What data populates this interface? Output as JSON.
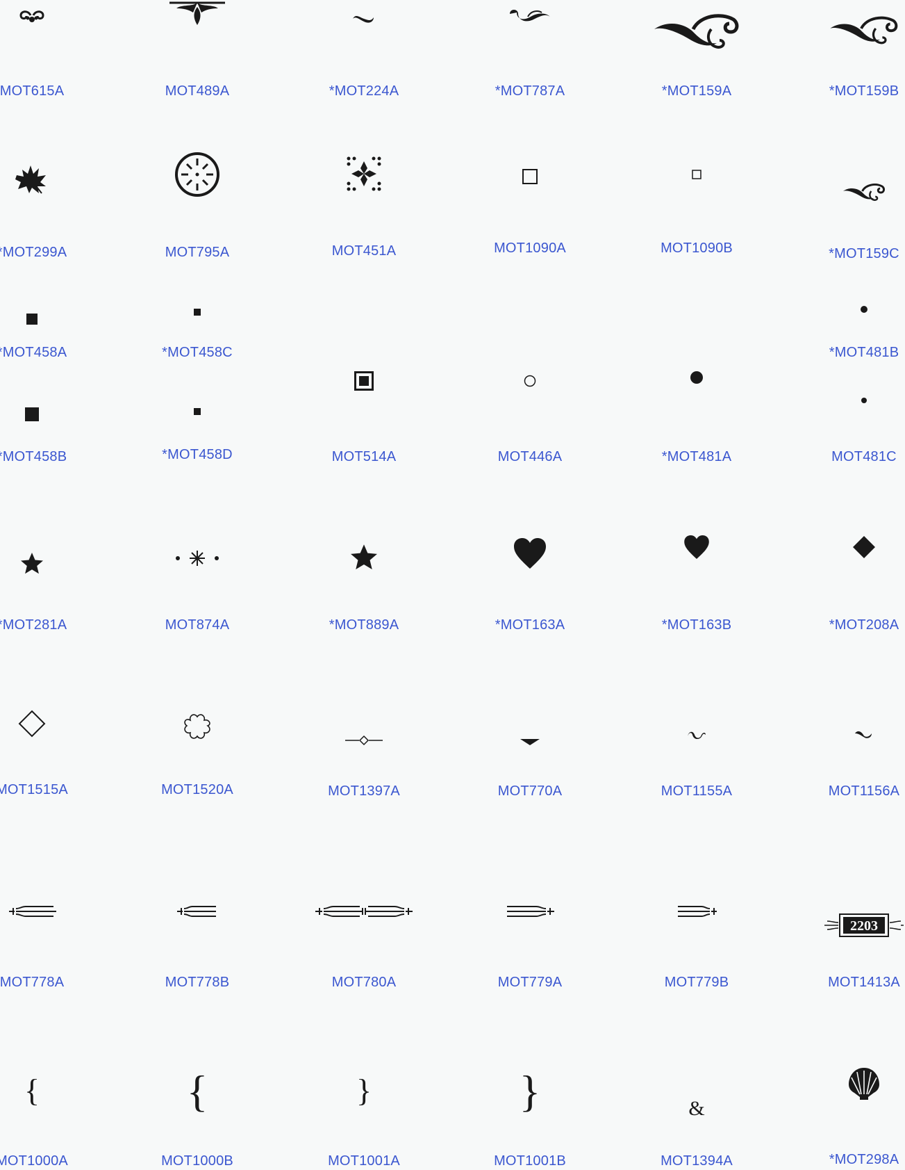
{
  "colors": {
    "background": "#f7f9f9",
    "link": "#3b57d0",
    "glyph": "#1a1a1a"
  },
  "motifs": [
    {
      "code": "MOT615A",
      "icon": "scroll-dots-ornament-icon"
    },
    {
      "code": "MOT489A",
      "icon": "hanging-leaf-ornament-icon"
    },
    {
      "code": "*MOT224A",
      "icon": "small-swash-icon"
    },
    {
      "code": "*MOT787A",
      "icon": "flourish-swash-icon"
    },
    {
      "code": "*MOT159A",
      "icon": "large-scroll-flourish-icon"
    },
    {
      "code": "*MOT159B",
      "icon": "scroll-flourish-icon"
    },
    {
      "code": "*MOT299A",
      "icon": "maple-leaf-icon"
    },
    {
      "code": "MOT795A",
      "icon": "circle-rosette-icon"
    },
    {
      "code": "MOT451A",
      "icon": "snowflake-tile-icon"
    },
    {
      "code": "MOT1090A",
      "icon": "outline-square-icon"
    },
    {
      "code": "MOT1090B",
      "icon": "small-outline-square-icon"
    },
    {
      "code": "*MOT159C",
      "icon": "small-scroll-flourish-icon"
    },
    {
      "code": "*MOT458A",
      "icon": "filled-square-icon"
    },
    {
      "code": "*MOT458C",
      "icon": "tiny-filled-square-icon"
    },
    {
      "code": "*MOT481B",
      "icon": "small-dot-icon"
    },
    {
      "code": "*MOT458B",
      "icon": "large-filled-square-icon"
    },
    {
      "code": "*MOT458D",
      "icon": "tiny-filled-square-icon"
    },
    {
      "code": "MOT514A",
      "icon": "framed-square-icon"
    },
    {
      "code": "MOT446A",
      "icon": "outline-circle-icon"
    },
    {
      "code": "*MOT481A",
      "icon": "filled-dot-icon"
    },
    {
      "code": "MOT481C",
      "icon": "tiny-dot-icon"
    },
    {
      "code": "*MOT281A",
      "icon": "star-icon"
    },
    {
      "code": "MOT874A",
      "icon": "sparkle-dots-icon"
    },
    {
      "code": "*MOT889A",
      "icon": "star-icon"
    },
    {
      "code": "*MOT163A",
      "icon": "heart-icon"
    },
    {
      "code": "*MOT163B",
      "icon": "small-heart-icon"
    },
    {
      "code": "*MOT208A",
      "icon": "filled-diamond-icon"
    },
    {
      "code": "MOT1515A",
      "icon": "outline-diamond-icon"
    },
    {
      "code": "MOT1520A",
      "icon": "quatrefoil-icon"
    },
    {
      "code": "MOT1397A",
      "icon": "line-diamond-divider-icon"
    },
    {
      "code": "MOT770A",
      "icon": "chevron-point-icon"
    },
    {
      "code": "MOT1155A",
      "icon": "tiny-swash-icon"
    },
    {
      "code": "MOT1156A",
      "icon": "tiny-swash-icon"
    },
    {
      "code": "MOT778A",
      "icon": "double-line-divider-icon"
    },
    {
      "code": "MOT778B",
      "icon": "short-double-line-divider-icon"
    },
    {
      "code": "MOT780A",
      "icon": "long-double-line-divider-icon"
    },
    {
      "code": "MOT779A",
      "icon": "double-line-divider-icon"
    },
    {
      "code": "MOT779B",
      "icon": "short-double-line-divider-icon"
    },
    {
      "code": "MOT1413A",
      "icon": "number-plaque-icon",
      "plaque_text": "2203"
    },
    {
      "code": "MOT1000A",
      "icon": "left-brace-icon"
    },
    {
      "code": "MOT1000B",
      "icon": "large-left-brace-icon"
    },
    {
      "code": "MOT1001A",
      "icon": "right-brace-icon"
    },
    {
      "code": "MOT1001B",
      "icon": "large-right-brace-icon"
    },
    {
      "code": "MOT1394A",
      "icon": "ampersand-icon"
    },
    {
      "code": "*MOT298A",
      "icon": "scallop-shell-icon"
    }
  ]
}
